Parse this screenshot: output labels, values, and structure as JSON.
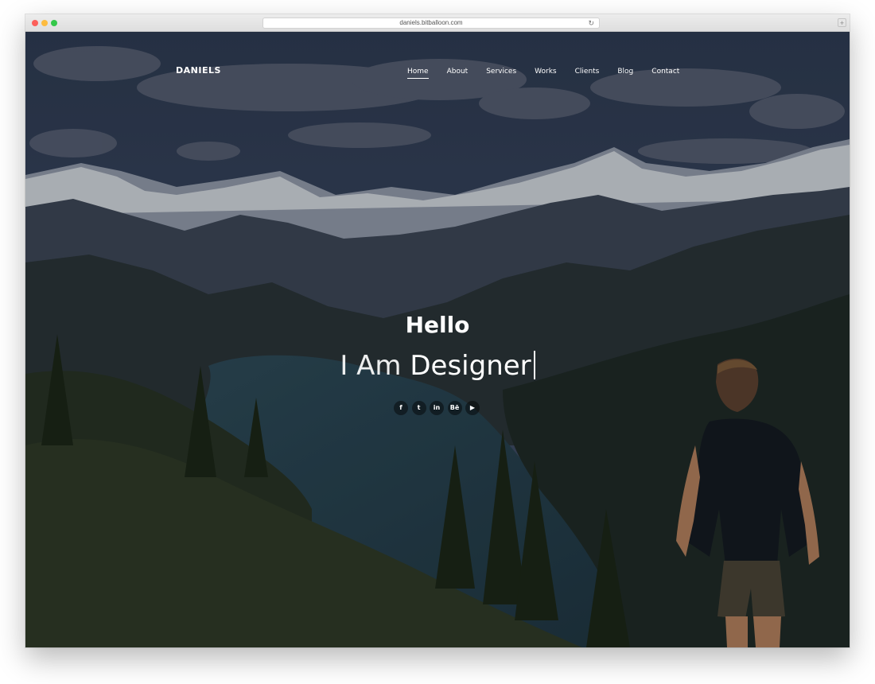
{
  "browser": {
    "url": "daniels.bitballoon.com"
  },
  "site": {
    "logo": "DANIELS",
    "nav": [
      "Home",
      "About",
      "Services",
      "Works",
      "Clients",
      "Blog",
      "Contact"
    ],
    "active_nav": "Home"
  },
  "hero": {
    "hello": "Hello",
    "prefix": "I Am",
    "role": "Designer"
  },
  "social": [
    {
      "name": "facebook-icon",
      "glyph": "f"
    },
    {
      "name": "twitter-icon",
      "glyph": "t"
    },
    {
      "name": "linkedin-icon",
      "glyph": "in"
    },
    {
      "name": "behance-icon",
      "glyph": "Bē"
    },
    {
      "name": "youtube-icon",
      "glyph": "▶"
    }
  ]
}
